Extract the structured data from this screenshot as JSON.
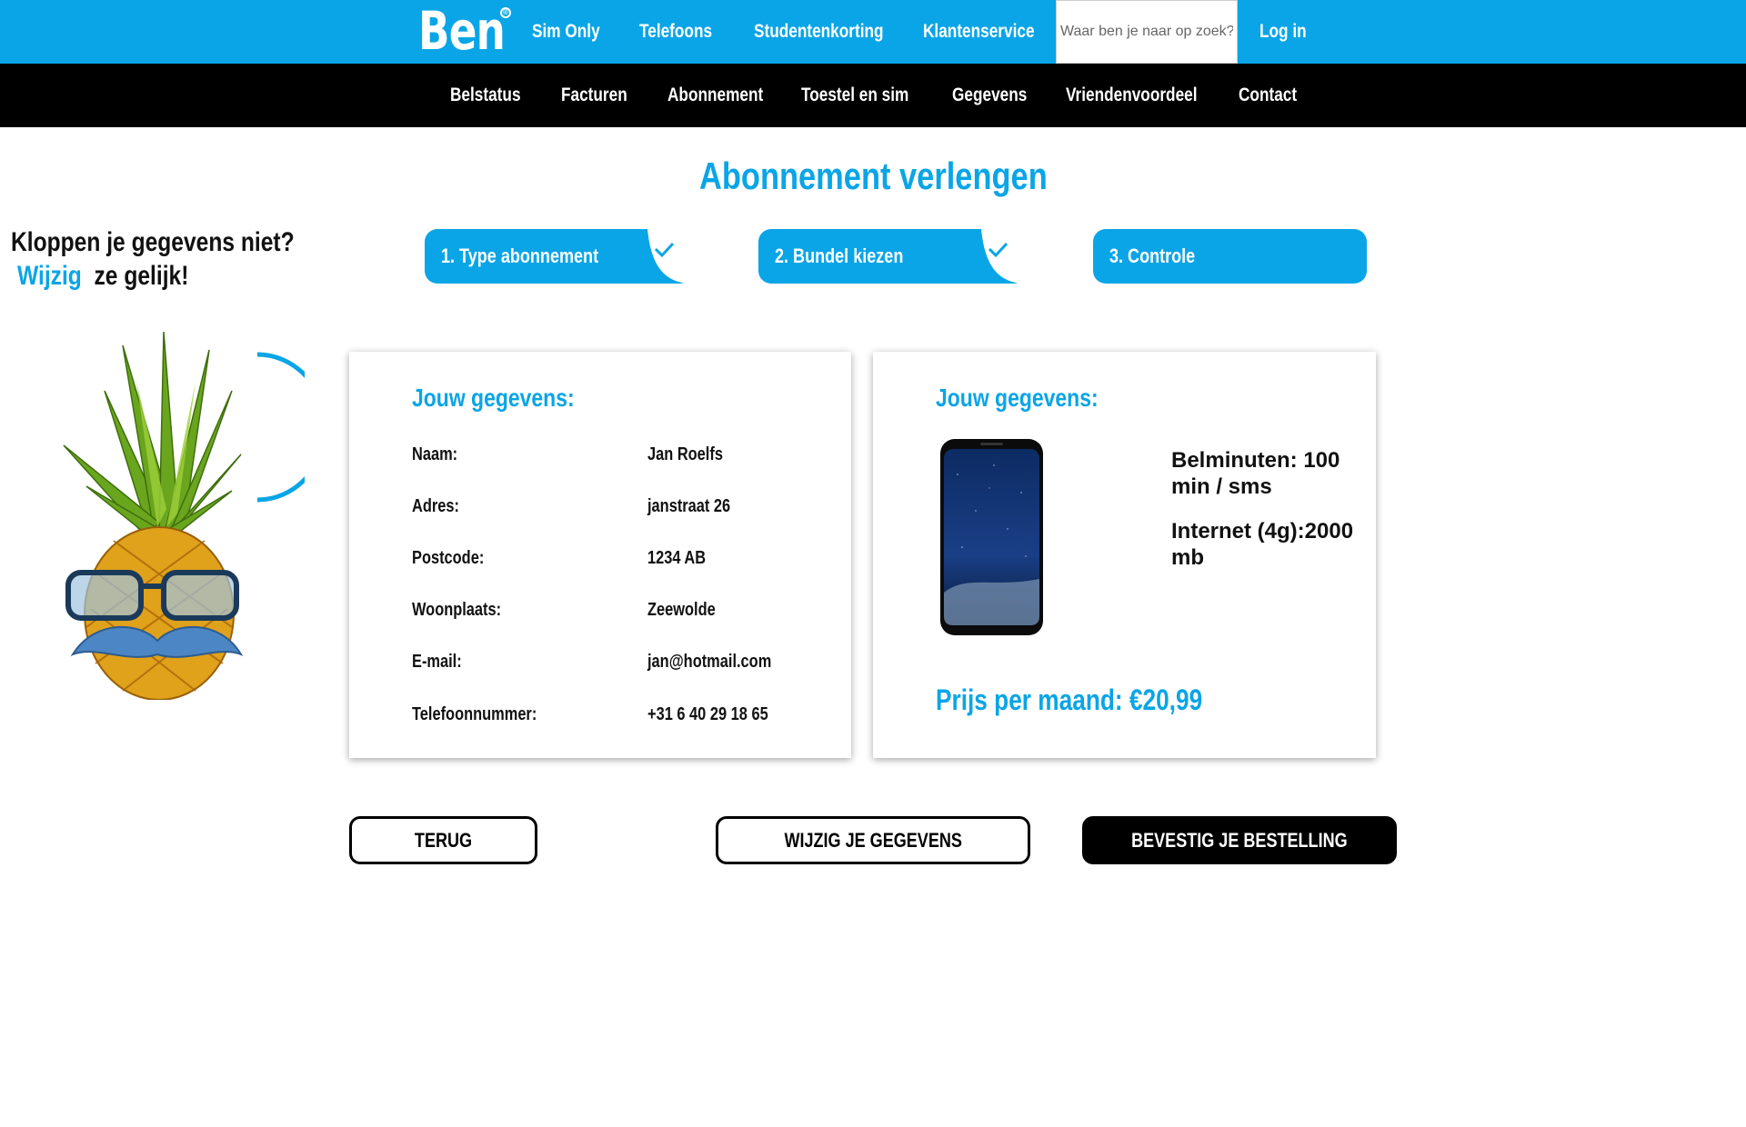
{
  "header": {
    "logo": "Ben",
    "logo_mark": "®",
    "nav": [
      "Sim Only",
      "Telefoons",
      "Studentenkorting",
      "Klantenservice"
    ],
    "search_placeholder": "Waar ben je naar op zoek?",
    "login": "Log in"
  },
  "subnav": [
    "Belstatus",
    "Facturen",
    "Abonnement",
    "Toestel en sim",
    "Gegevens",
    "Vriendenvoordeel",
    "Contact"
  ],
  "page_title": "Abonnement verlengen",
  "left": {
    "line1": "Kloppen je gegevens niet?",
    "link": "Wijzig",
    "line2_rest": "ze gelijk!"
  },
  "steps": [
    {
      "label": "1. Type abonnement",
      "done": true
    },
    {
      "label": "2. Bundel kiezen",
      "done": true
    },
    {
      "label": "3. Controle",
      "done": false
    }
  ],
  "personal_card": {
    "title": "Jouw gegevens:",
    "rows": [
      {
        "label": "Naam:",
        "value": "Jan Roelfs"
      },
      {
        "label": "Adres:",
        "value": "janstraat 26"
      },
      {
        "label": "Postcode:",
        "value": "1234 AB"
      },
      {
        "label": "Woonplaats:",
        "value": "Zeewolde"
      },
      {
        "label": "E-mail:",
        "value": "jan@hotmail.com"
      },
      {
        "label": "Telefoonnummer:",
        "value": "+31 6 40 29 18 65"
      }
    ]
  },
  "plan_card": {
    "title": "Jouw gegevens:",
    "spec1": "Belminuten: 100 min / sms",
    "spec2": "Internet (4g):2000 mb",
    "price": "Prijs per maand: €20,99"
  },
  "buttons": {
    "back": "TERUG",
    "edit": "WIJZIG JE GEGEVENS",
    "confirm": "BEVESTIG JE BESTELLING"
  },
  "colors": {
    "accent": "#0aa5e6",
    "dark": "#000000"
  }
}
